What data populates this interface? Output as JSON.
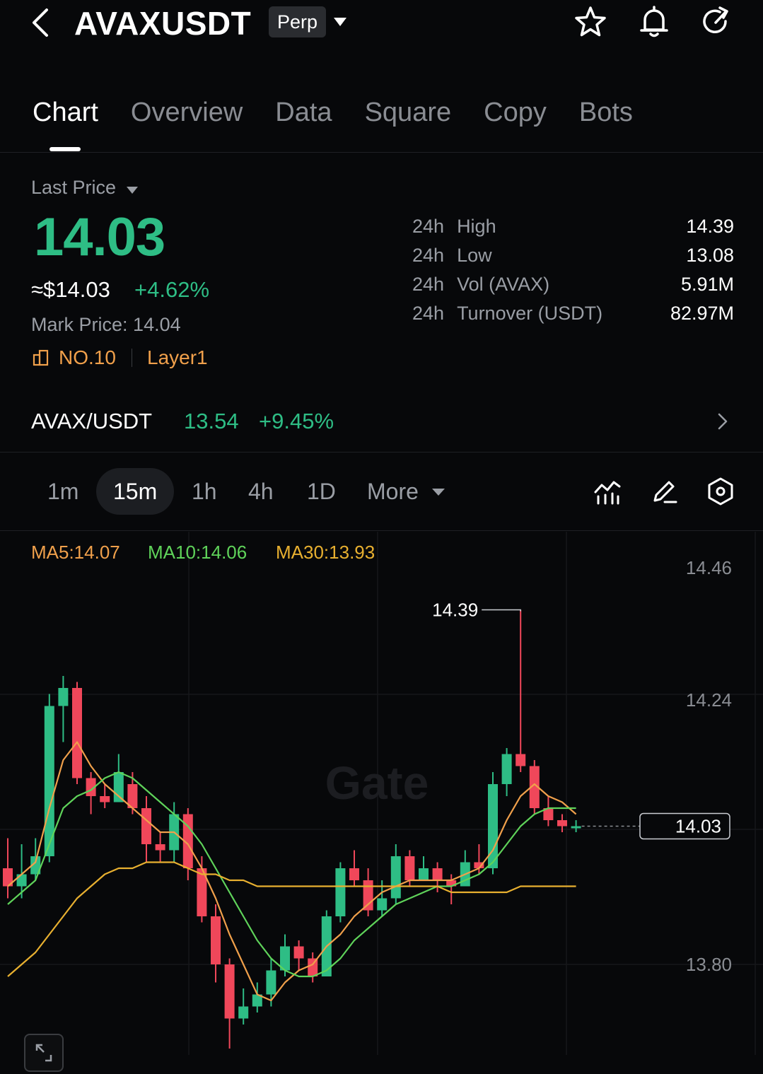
{
  "header": {
    "title": "AVAXUSDT",
    "badge": "Perp",
    "icons": [
      "back-icon",
      "star-icon",
      "bell-icon",
      "share-icon"
    ]
  },
  "tabs": [
    "Chart",
    "Overview",
    "Data",
    "Square",
    "Copy",
    "Bots"
  ],
  "active_tab": "Chart",
  "price": {
    "label": "Last Price",
    "last": "14.03",
    "usd": "≈$14.03",
    "change_pct": "+4.62%",
    "mark_label": "Mark Price:",
    "mark_value": "14.04",
    "rank": "NO.10",
    "category": "Layer1",
    "up_color": "#2ebd85",
    "down_color": "#f0475a"
  },
  "stats": [
    {
      "prefix": "24h",
      "label": "High",
      "value": "14.39"
    },
    {
      "prefix": "24h",
      "label": "Low",
      "value": "13.08"
    },
    {
      "prefix": "24h",
      "label": "Vol (AVAX)",
      "value": "5.91M"
    },
    {
      "prefix": "24h",
      "label": "Turnover (USDT)",
      "value": "82.97M"
    }
  ],
  "spot": {
    "pair": "AVAX/USDT",
    "price": "13.54",
    "change_pct": "+9.45%"
  },
  "timeframes": [
    "1m",
    "15m",
    "1h",
    "4h",
    "1D",
    "More"
  ],
  "active_timeframe": "15m",
  "toolbar_icons": [
    "indicator-icon",
    "draw-icon",
    "settings-icon"
  ],
  "ma": [
    {
      "label": "MA5:14.07",
      "color": "#f0a04b"
    },
    {
      "label": "MA10:14.06",
      "color": "#5fd35a"
    },
    {
      "label": "MA30:13.93",
      "color": "#e8b030"
    }
  ],
  "watermark": "Gate",
  "chart_data": {
    "type": "candlestick",
    "y_axis_ticks": [
      "14.46",
      "14.24",
      "13.80"
    ],
    "current_price": "14.03",
    "high_marker": "14.39",
    "low_marker": "13.66",
    "candles": [
      {
        "o": 13.96,
        "c": 13.93,
        "h": 14.01,
        "l": 13.91
      },
      {
        "o": 13.93,
        "c": 13.95,
        "h": 14.0,
        "l": 13.91
      },
      {
        "o": 13.95,
        "c": 13.98,
        "h": 14.01,
        "l": 13.94
      },
      {
        "o": 13.98,
        "c": 14.23,
        "h": 14.25,
        "l": 13.97
      },
      {
        "o": 14.23,
        "c": 14.26,
        "h": 14.28,
        "l": 14.17
      },
      {
        "o": 14.26,
        "c": 14.11,
        "h": 14.27,
        "l": 14.1
      },
      {
        "o": 14.11,
        "c": 14.08,
        "h": 14.12,
        "l": 14.05
      },
      {
        "o": 14.08,
        "c": 14.07,
        "h": 14.1,
        "l": 14.06
      },
      {
        "o": 14.07,
        "c": 14.12,
        "h": 14.15,
        "l": 14.07
      },
      {
        "o": 14.1,
        "c": 14.06,
        "h": 14.12,
        "l": 14.05
      },
      {
        "o": 14.06,
        "c": 14.0,
        "h": 14.08,
        "l": 13.97
      },
      {
        "o": 14.0,
        "c": 13.99,
        "h": 14.02,
        "l": 13.97
      },
      {
        "o": 13.99,
        "c": 14.05,
        "h": 14.07,
        "l": 13.97
      },
      {
        "o": 14.05,
        "c": 13.96,
        "h": 14.06,
        "l": 13.94
      },
      {
        "o": 13.96,
        "c": 13.88,
        "h": 13.98,
        "l": 13.87
      },
      {
        "o": 13.88,
        "c": 13.8,
        "h": 13.9,
        "l": 13.77
      },
      {
        "o": 13.8,
        "c": 13.71,
        "h": 13.81,
        "l": 13.66
      },
      {
        "o": 13.71,
        "c": 13.73,
        "h": 13.76,
        "l": 13.7
      },
      {
        "o": 13.73,
        "c": 13.75,
        "h": 13.77,
        "l": 13.72
      },
      {
        "o": 13.75,
        "c": 13.79,
        "h": 13.81,
        "l": 13.73
      },
      {
        "o": 13.79,
        "c": 13.83,
        "h": 13.85,
        "l": 13.78
      },
      {
        "o": 13.83,
        "c": 13.81,
        "h": 13.84,
        "l": 13.79
      },
      {
        "o": 13.81,
        "c": 13.78,
        "h": 13.82,
        "l": 13.77
      },
      {
        "o": 13.78,
        "c": 13.88,
        "h": 13.89,
        "l": 13.78
      },
      {
        "o": 13.88,
        "c": 13.96,
        "h": 13.97,
        "l": 13.87
      },
      {
        "o": 13.96,
        "c": 13.94,
        "h": 13.99,
        "l": 13.93
      },
      {
        "o": 13.94,
        "c": 13.89,
        "h": 13.96,
        "l": 13.88
      },
      {
        "o": 13.89,
        "c": 13.91,
        "h": 13.94,
        "l": 13.88
      },
      {
        "o": 13.91,
        "c": 13.98,
        "h": 14.0,
        "l": 13.9
      },
      {
        "o": 13.98,
        "c": 13.94,
        "h": 13.99,
        "l": 13.93
      },
      {
        "o": 13.94,
        "c": 13.96,
        "h": 13.98,
        "l": 13.94
      },
      {
        "o": 13.96,
        "c": 13.94,
        "h": 13.97,
        "l": 13.92
      },
      {
        "o": 13.94,
        "c": 13.93,
        "h": 13.95,
        "l": 13.9
      },
      {
        "o": 13.93,
        "c": 13.97,
        "h": 13.99,
        "l": 13.93
      },
      {
        "o": 13.97,
        "c": 13.96,
        "h": 14.0,
        "l": 13.95
      },
      {
        "o": 13.96,
        "c": 14.1,
        "h": 14.12,
        "l": 13.95
      },
      {
        "o": 14.1,
        "c": 14.15,
        "h": 14.16,
        "l": 14.08
      },
      {
        "o": 14.15,
        "c": 14.13,
        "h": 14.39,
        "l": 14.12
      },
      {
        "o": 14.13,
        "c": 14.06,
        "h": 14.14,
        "l": 14.05
      },
      {
        "o": 14.06,
        "c": 14.04,
        "h": 14.08,
        "l": 14.03
      },
      {
        "o": 14.04,
        "c": 14.03,
        "h": 14.05,
        "l": 14.02
      },
      {
        "o": 14.03,
        "c": 14.03,
        "h": 14.04,
        "l": 14.02
      }
    ],
    "ma5": [
      13.93,
      13.95,
      13.97,
      14.06,
      14.14,
      14.17,
      14.13,
      14.1,
      14.08,
      14.06,
      14.04,
      14.02,
      14.02,
      14.0,
      13.96,
      13.91,
      13.85,
      13.8,
      13.75,
      13.74,
      13.77,
      13.79,
      13.8,
      13.83,
      13.85,
      13.88,
      13.9,
      13.92,
      13.93,
      13.94,
      13.94,
      13.94,
      13.94,
      13.95,
      13.96,
      13.99,
      14.04,
      14.08,
      14.1,
      14.08,
      14.07,
      14.05
    ],
    "ma10": [
      13.9,
      13.92,
      13.94,
      14.0,
      14.06,
      14.08,
      14.09,
      14.11,
      14.12,
      14.11,
      14.09,
      14.07,
      14.05,
      14.03,
      14.0,
      13.96,
      13.92,
      13.88,
      13.84,
      13.81,
      13.79,
      13.78,
      13.78,
      13.79,
      13.81,
      13.84,
      13.86,
      13.88,
      13.9,
      13.91,
      13.92,
      13.93,
      13.93,
      13.94,
      13.95,
      13.97,
      14.0,
      14.03,
      14.05,
      14.06,
      14.06,
      14.06
    ],
    "ma30": [
      13.78,
      13.8,
      13.82,
      13.85,
      13.88,
      13.91,
      13.93,
      13.95,
      13.96,
      13.96,
      13.97,
      13.97,
      13.97,
      13.96,
      13.95,
      13.95,
      13.94,
      13.94,
      13.93,
      13.93,
      13.93,
      13.93,
      13.93,
      13.93,
      13.93,
      13.93,
      13.93,
      13.93,
      13.93,
      13.93,
      13.93,
      13.93,
      13.92,
      13.92,
      13.92,
      13.92,
      13.92,
      13.93,
      13.93,
      13.93,
      13.93,
      13.93
    ]
  }
}
